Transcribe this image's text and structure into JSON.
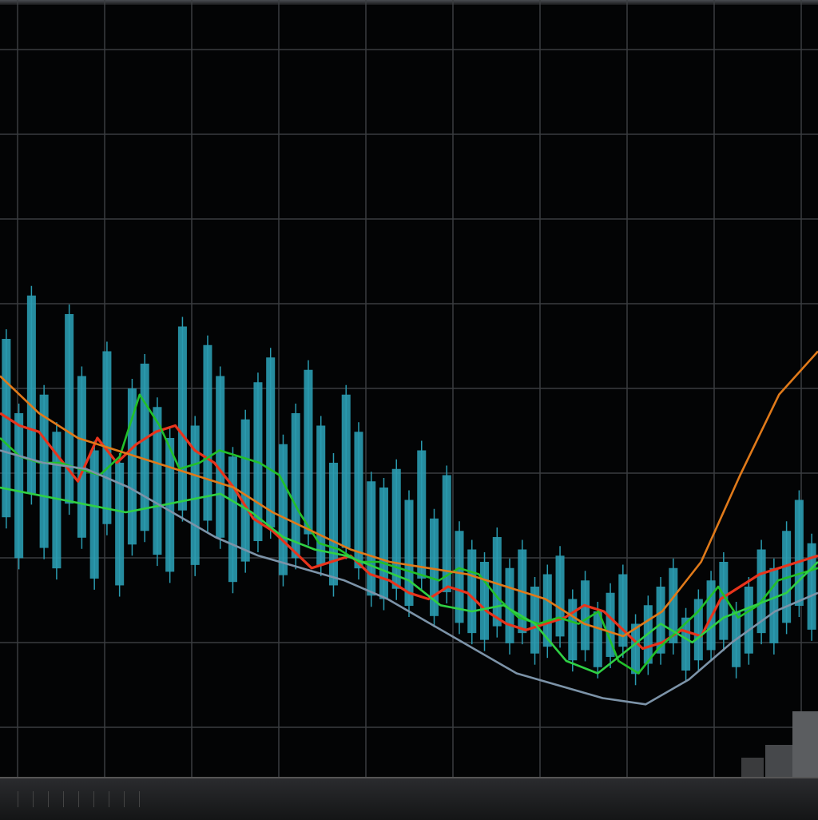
{
  "chart_data": {
    "type": "line",
    "title": "",
    "xlabel": "",
    "ylabel": "",
    "grid": true,
    "legend": "top-right",
    "legend_entries": [
      "",
      ""
    ],
    "bars": {
      "color": "#2a9bb0",
      "values": [
        64,
        52,
        71,
        55,
        49,
        68,
        58,
        46,
        62,
        44,
        56,
        60,
        53,
        48,
        66,
        50,
        63,
        58,
        45,
        51,
        57,
        61,
        47,
        52,
        59,
        50,
        44,
        55,
        49,
        41,
        40,
        43,
        38,
        46,
        35,
        42,
        33,
        30,
        28,
        32,
        27,
        30,
        24,
        26,
        29,
        22,
        25,
        20,
        23,
        26,
        18,
        21,
        24,
        27,
        19,
        22,
        25,
        28,
        20,
        24,
        30,
        27,
        33,
        38,
        31
      ]
    },
    "series": [
      {
        "color": "#e8341c",
        "values": [
          52,
          50,
          49,
          45,
          41,
          48,
          44,
          47,
          49,
          50,
          46,
          44,
          40,
          35,
          33,
          30,
          27,
          28,
          29,
          26,
          25,
          23,
          22,
          24,
          23,
          20,
          18,
          17,
          18,
          19,
          21,
          20,
          17,
          14,
          15,
          17,
          16,
          22,
          24,
          26,
          27,
          28,
          29
        ]
      },
      {
        "color": "#22c02a",
        "values": [
          48,
          45,
          44,
          44,
          43,
          42,
          45,
          55,
          50,
          43,
          44,
          46,
          45,
          44,
          42,
          36,
          31,
          30,
          28,
          28,
          27,
          26,
          25,
          27,
          26,
          22,
          19,
          18,
          19,
          18,
          20,
          12,
          10,
          14,
          17,
          20,
          24,
          19,
          21,
          25,
          26,
          27
        ]
      },
      {
        "color": "#2fd044",
        "values": [
          40,
          39,
          38,
          37,
          36,
          37,
          38,
          39,
          36,
          32,
          30,
          29,
          27,
          25,
          21,
          20,
          21,
          18,
          12,
          10,
          14,
          18,
          15,
          19,
          21,
          23,
          28
        ]
      },
      {
        "color": "#e07a1a",
        "values": [
          58,
          52,
          48,
          46,
          44,
          42,
          40,
          36,
          33,
          30,
          28,
          27,
          26,
          24,
          22,
          18,
          16,
          20,
          28,
          42,
          55,
          62
        ]
      },
      {
        "color": "#7c93a8",
        "values": [
          46,
          44,
          43,
          40,
          36,
          32,
          29,
          27,
          25,
          22,
          18,
          14,
          10,
          8,
          6,
          5,
          9,
          15,
          20,
          23
        ]
      }
    ]
  },
  "legend_text": [
    "",
    ""
  ],
  "ticker_items": [
    {
      "text": "",
      "color": "#e8341c"
    },
    {
      "text": "",
      "color": "#9a9a9a"
    },
    {
      "text": "",
      "color": "#cfcfcf"
    },
    {
      "text": "",
      "color": "#e8341c"
    },
    {
      "text": "",
      "color": "#cfcfcf"
    },
    {
      "text": "",
      "color": "#e8341c"
    },
    {
      "text": "",
      "color": "#cfcfcf"
    },
    {
      "text": "",
      "color": "#cfcfcf"
    },
    {
      "text": "",
      "color": "#e8341c"
    }
  ]
}
